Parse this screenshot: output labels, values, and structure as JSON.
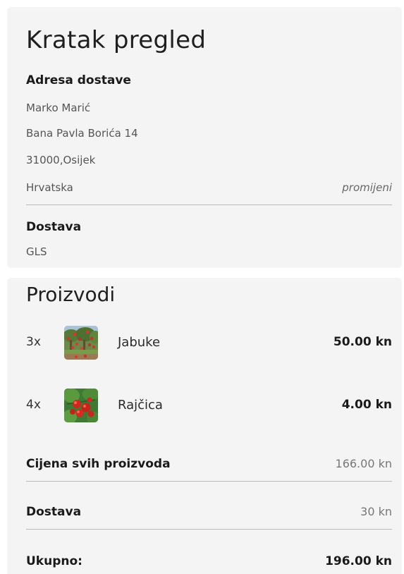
{
  "summary": {
    "title": "Kratak pregled",
    "address_heading": "Adresa dostave",
    "address_lines": [
      "Marko Marić",
      "Bana Pavla Borića 14",
      "31000,Osijek",
      "Hrvatska"
    ],
    "change_link": "promijeni",
    "delivery_heading": "Dostava",
    "delivery_method": "GLS"
  },
  "products": {
    "title": "Proizvodi",
    "items": [
      {
        "qty": "3x",
        "name": "Jabuke",
        "price": "50.00 kn",
        "image_icon": "apples-photo"
      },
      {
        "qty": "4x",
        "name": "Rajčica",
        "price": "4.00 kn",
        "image_icon": "tomatoes-photo"
      }
    ],
    "subtotal_label": "Cijena svih proizvoda",
    "subtotal_value": "166.00 kn",
    "shipping_label": "Dostava",
    "shipping_value": "30 kn",
    "total_label": "Ukupno:",
    "total_value": "196.00 kn"
  }
}
